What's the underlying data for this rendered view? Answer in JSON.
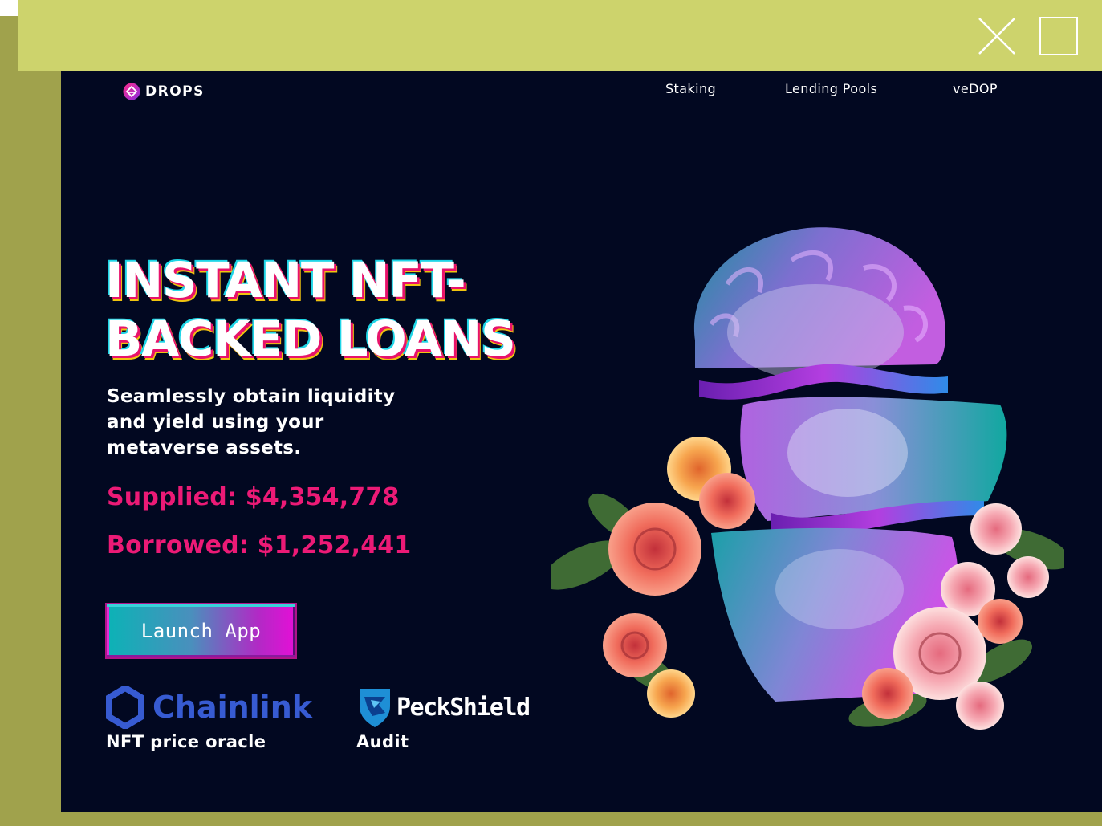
{
  "window": {
    "close_icon": "close-icon",
    "maximize_icon": "maximize-icon"
  },
  "brand": {
    "name": "DROPS",
    "icon": "drops-logo-icon"
  },
  "nav": {
    "items": [
      {
        "label": "Staking"
      },
      {
        "label": "Lending Pools"
      },
      {
        "label": "veDOP"
      }
    ]
  },
  "hero": {
    "title_line1": "INSTANT NFT-",
    "title_line2": "BACKED LOANS",
    "subtitle": "Seamlessly obtain liquidity and yield using your metaverse assets.",
    "supplied": "Supplied: $4,354,778",
    "borrowed": "Borrowed: $1,252,441",
    "cta_label": "Launch App"
  },
  "partners": [
    {
      "name": "Chainlink",
      "caption": "NFT price oracle",
      "icon": "chainlink-hexagon-icon"
    },
    {
      "name": "PeckShield",
      "caption": "Audit",
      "icon": "peckshield-shield-icon"
    }
  ],
  "illustration": {
    "icon": "statue-with-roses-illustration"
  },
  "colors": {
    "topbar": "#cdd36c",
    "frame": "#a0a24c",
    "page_bg": "#020821",
    "accent_pink": "#ec1a76",
    "chainlink_blue": "#375bd2",
    "teal": "#0bb3b6",
    "magenta": "#e50fd7"
  }
}
